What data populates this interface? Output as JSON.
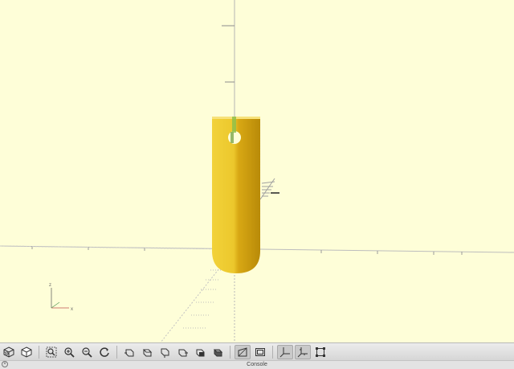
{
  "viewport": {
    "background": "#fefed8",
    "model_color": "#e8c832",
    "axis_labels": {
      "z": "z",
      "x": "x"
    }
  },
  "toolbar": {
    "buttons": [
      {
        "name": "view-all-icon",
        "active": false
      },
      {
        "name": "reset-view-icon",
        "active": false
      },
      {
        "name": "zoom-all-icon",
        "active": false
      },
      {
        "name": "zoom-in-icon",
        "active": false
      },
      {
        "name": "zoom-out-icon",
        "active": false
      },
      {
        "name": "rotate-reset-icon",
        "active": false
      },
      {
        "name": "view-right-icon",
        "active": false
      },
      {
        "name": "view-top-icon",
        "active": false
      },
      {
        "name": "view-bottom-icon",
        "active": false
      },
      {
        "name": "view-left-icon",
        "active": false
      },
      {
        "name": "view-front-icon",
        "active": false
      },
      {
        "name": "view-back-icon",
        "active": false
      },
      {
        "name": "perspective-icon",
        "active": true
      },
      {
        "name": "orthogonal-icon",
        "active": false
      },
      {
        "name": "show-axes-icon",
        "active": true
      },
      {
        "name": "show-scale-markers-icon",
        "active": true
      },
      {
        "name": "show-edges-icon",
        "active": false
      }
    ]
  },
  "statusbar": {
    "label": "Console",
    "close_glyph": "×",
    "expand_glyph": "»"
  }
}
